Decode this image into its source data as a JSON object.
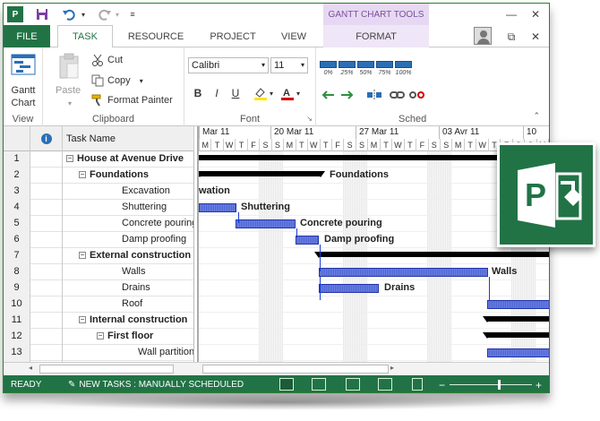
{
  "window": {
    "context_tab_header": "GANTT CHART TOOLS",
    "quick_access": {
      "app_icon_letter": "P"
    }
  },
  "tabs": [
    {
      "label": "FILE"
    },
    {
      "label": "TASK"
    },
    {
      "label": "RESOURCE"
    },
    {
      "label": "PROJECT"
    },
    {
      "label": "VIEW"
    },
    {
      "label": "FORMAT"
    }
  ],
  "ribbon": {
    "view_group": {
      "button": "Gantt Chart",
      "button_line1": "Gantt",
      "button_line2": "Chart",
      "label": "View"
    },
    "clipboard_group": {
      "paste": "Paste",
      "cut": "Cut",
      "copy": "Copy",
      "format_painter": "Format Painter",
      "label": "Clipboard"
    },
    "font_group": {
      "font_name": "Calibri",
      "font_size": "11",
      "bold": "B",
      "italic": "I",
      "underline": "U",
      "label": "Font"
    },
    "schedule_group": {
      "label": "Sched",
      "percent_buttons": [
        "0%",
        "25%",
        "50%",
        "75%",
        "100%"
      ]
    }
  },
  "table": {
    "headers": {
      "indicators_icon": "info-icon",
      "task_name": "Task Name"
    },
    "rows": [
      {
        "id": "1",
        "name": "House at Avenue Drive",
        "level": 0,
        "summary": true
      },
      {
        "id": "2",
        "name": "Foundations",
        "level": 1,
        "summary": true
      },
      {
        "id": "3",
        "name": "Excavation",
        "level": 2,
        "summary": false
      },
      {
        "id": "4",
        "name": "Shuttering",
        "level": 2,
        "summary": false
      },
      {
        "id": "5",
        "name": "Concrete pouring",
        "level": 2,
        "summary": false
      },
      {
        "id": "6",
        "name": "Damp proofing",
        "level": 2,
        "summary": false
      },
      {
        "id": "7",
        "name": "External construction",
        "level": 1,
        "summary": true
      },
      {
        "id": "8",
        "name": "Walls",
        "level": 2,
        "summary": false
      },
      {
        "id": "9",
        "name": "Drains",
        "level": 2,
        "summary": false
      },
      {
        "id": "10",
        "name": "Roof",
        "level": 2,
        "summary": false
      },
      {
        "id": "11",
        "name": "Internal construction",
        "level": 1,
        "summary": true
      },
      {
        "id": "12",
        "name": "First floor",
        "level": 2,
        "summary": true
      },
      {
        "id": "13",
        "name": "Wall partitions",
        "level": 3,
        "summary": false
      }
    ]
  },
  "timescale": {
    "weeks": [
      "Mar 11",
      "20 Mar 11",
      "27 Mar 11",
      "03 Avr 11",
      "10"
    ],
    "days": [
      "M",
      "T",
      "W",
      "T",
      "F",
      "S",
      "S",
      "M",
      "T",
      "W",
      "T",
      "F",
      "S",
      "S",
      "M",
      "T",
      "W",
      "T",
      "F",
      "S",
      "S",
      "M",
      "T",
      "W",
      "T",
      "F",
      "S",
      "S",
      "M",
      "T",
      "W",
      "T",
      "F",
      "S",
      "S"
    ]
  },
  "gantt_labels": {
    "foundations": "Foundations",
    "excavation": "wation",
    "shuttering": "Shuttering",
    "concrete": "Concrete pouring",
    "damp": "Damp proofing",
    "walls": "Walls",
    "drains": "Drains"
  },
  "status": {
    "ready": "READY",
    "new_tasks": "NEW TASKS : MANUALLY SCHEDULED"
  },
  "colors": {
    "brand_green": "#217346",
    "context_purple": "#7a4f9c",
    "task_bar_blue": "#4f66d4"
  }
}
